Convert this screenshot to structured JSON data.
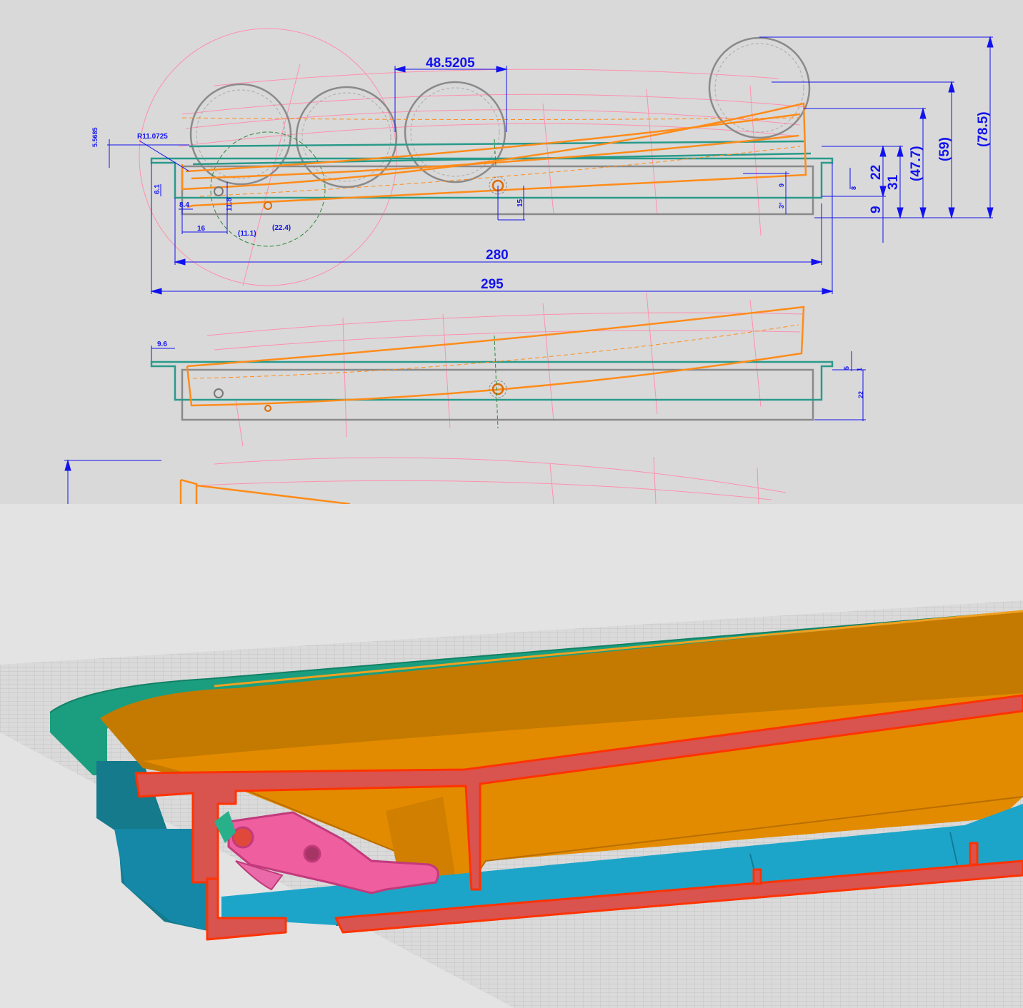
{
  "sketch": {
    "dimensions": {
      "width_295": "295",
      "width_280": "280",
      "pitch": "48.5205",
      "h_22": "22",
      "h_31": "31",
      "h_9": "9",
      "h_47_7": "(47.7)",
      "h_59": "(59)",
      "h_78_5": "(78.5)",
      "small_15": "15",
      "small_16": "16",
      "small_11_1": "(11.1)",
      "small_22_4": "(22.4)",
      "small_11_8": "11.8",
      "small_8_4": "8.4",
      "small_6_1": "6.1",
      "radius": "R11.0725",
      "offset_5_5685": "5.5685",
      "small_9": "9",
      "small_8": "8",
      "angle_3": "3°",
      "lower_9_6": "9.6",
      "lower_5": "5",
      "lower_1": "1",
      "lower_22": "22"
    },
    "colors": {
      "dimension": "#1212ee",
      "tray": "#2a9a8a",
      "base": "#8a8a8a",
      "slide": "#ff8c1a",
      "construction": "#ff7fa0",
      "circle": "#8a8a8a"
    }
  },
  "model": {
    "colors": {
      "background": "#e3e3e3",
      "grid": "#c8c8c8",
      "lid_green": "#1a9e7f",
      "slide_orange": "#e38b00",
      "section_red": "#d9534f",
      "section_edge": "#ff3300",
      "base_blue": "#1da5c9",
      "latch_pink": "#ef5fa0"
    }
  }
}
